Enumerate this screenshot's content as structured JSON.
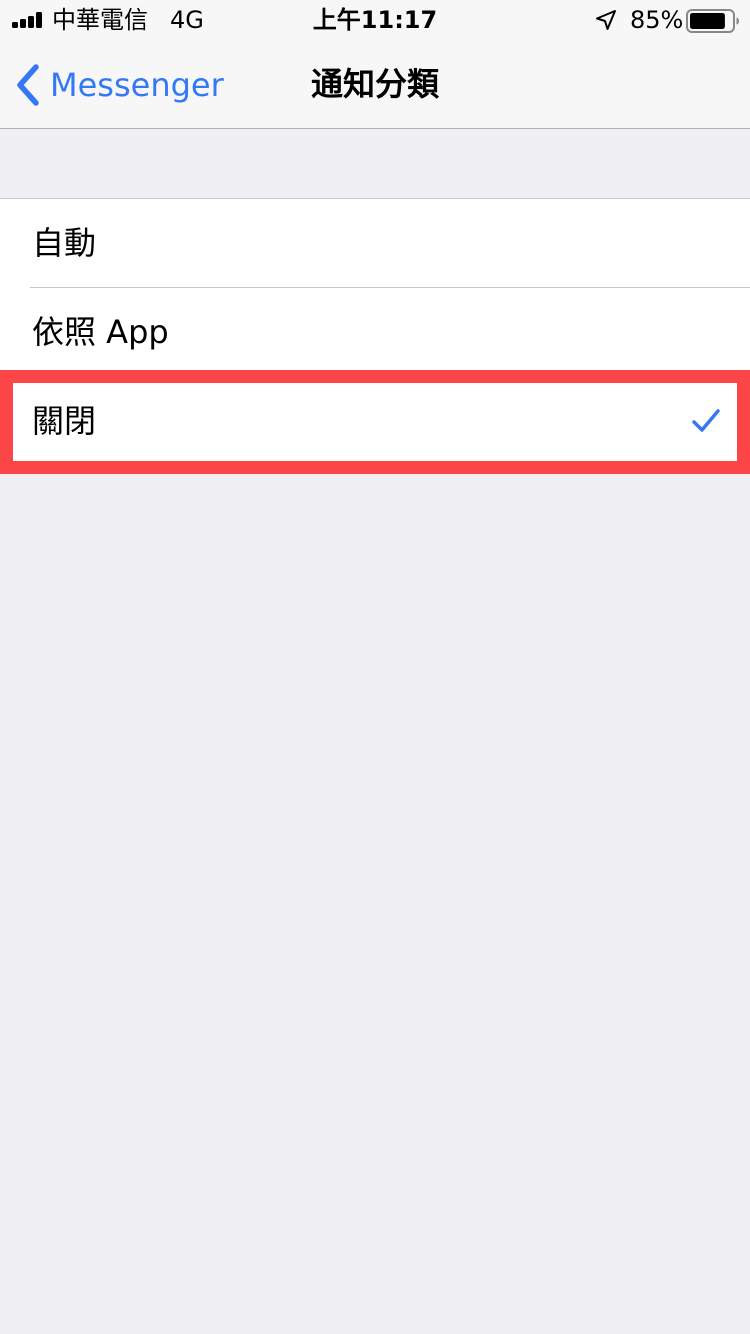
{
  "status_bar": {
    "carrier": "中華電信",
    "network": "4G",
    "time": "上午11:17",
    "battery_percent": "85%",
    "battery_level": 0.85,
    "icons": [
      "signal-bars-icon",
      "location-arrow-icon",
      "battery-icon"
    ]
  },
  "nav": {
    "back_label": "Messenger",
    "title": "通知分類",
    "back_icon": "chevron-left-icon"
  },
  "options": [
    {
      "label": "自動",
      "selected": false
    },
    {
      "label": "依照 App",
      "selected": false
    },
    {
      "label": "關閉",
      "selected": true
    }
  ],
  "colors": {
    "accent": "#3478f6",
    "highlight": "#fc4546",
    "background": "#efeff4"
  }
}
